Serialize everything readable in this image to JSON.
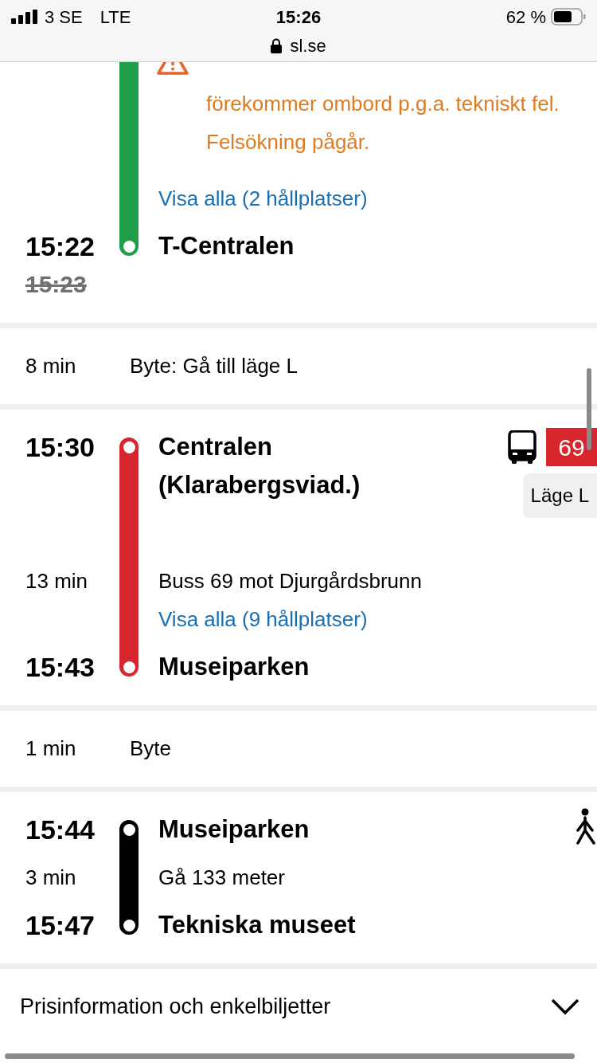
{
  "status_bar": {
    "carrier": "3 SE",
    "network": "LTE",
    "time": "15:26",
    "battery": "62 %"
  },
  "address_bar": {
    "url": "sl.se"
  },
  "journey": [
    {
      "kind": "metro",
      "color": "#1f9e4a",
      "continues_above": true,
      "rows": [
        {
          "kind": "warning",
          "text": "förekommer ombord p.g.a. tekniskt fel. Felsökning pågår."
        },
        {
          "kind": "link",
          "text": "Visa alla (2 hållplatser)"
        },
        {
          "kind": "stop",
          "time": "15:22",
          "old_time": "15:23",
          "name": "T-Centralen"
        }
      ]
    },
    {
      "kind": "transfer",
      "duration": "8 min",
      "text": "Byte: Gå till läge L"
    },
    {
      "kind": "bus",
      "color": "#d7262d",
      "line": "69",
      "position": "Läge L",
      "rows": [
        {
          "kind": "stop",
          "time": "15:30",
          "name": "Centralen (Klarabergsviad.)"
        },
        {
          "kind": "info",
          "duration": "13 min",
          "text": "Buss 69 mot Djurgårdsbrunn"
        },
        {
          "kind": "link",
          "text": "Visa alla (9 hållplatser)"
        },
        {
          "kind": "stop",
          "time": "15:43",
          "name": "Museiparken"
        }
      ]
    },
    {
      "kind": "transfer",
      "duration": "1 min",
      "text": "Byte"
    },
    {
      "kind": "walk",
      "color": "#000000",
      "rows": [
        {
          "kind": "stop",
          "time": "15:44",
          "name": "Museiparken"
        },
        {
          "kind": "info",
          "duration": "3 min",
          "text": "Gå 133 meter"
        },
        {
          "kind": "stop",
          "time": "15:47",
          "name": "Tekniska museet"
        }
      ]
    }
  ],
  "footer": {
    "label": "Prisinformation och enkelbiljetter",
    "expanded": false
  }
}
